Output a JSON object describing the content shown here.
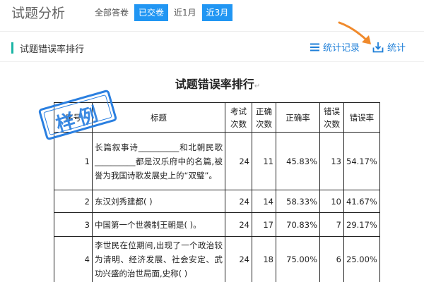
{
  "header": {
    "title": "试题分析",
    "filters": [
      {
        "label": "全部答卷",
        "active": false
      },
      {
        "label": "已交卷",
        "active": true
      },
      {
        "label": "近1月",
        "active": false
      },
      {
        "label": "近3月",
        "active": true
      }
    ]
  },
  "card": {
    "title": "试题错误率排行",
    "actions": {
      "records": "统计记录",
      "stats": "统计"
    },
    "accent_color": "#1bb5a5",
    "link_color": "#1e7fd8"
  },
  "document": {
    "title": "试题错误率排行",
    "return_mark": "↵",
    "stamp": "样例",
    "table": {
      "headers": [
        "序号",
        "标题",
        "考试次数",
        "正确次数",
        "正确率",
        "错误次数",
        "错误率"
      ],
      "rows": [
        {
          "index": "1",
          "title": "长篇叙事诗__________和北朝民歌__________都是汉乐府中的名篇,被誉为我国诗歌发展史上的“双璧”。",
          "exams": "24",
          "correct": "11",
          "correct_rate": "45.83%",
          "wrong": "13",
          "wrong_rate": "54.17%"
        },
        {
          "index": "2",
          "title": "东汉刘秀建都( )",
          "exams": "24",
          "correct": "14",
          "correct_rate": "58.33%",
          "wrong": "10",
          "wrong_rate": "41.67%"
        },
        {
          "index": "3",
          "title": "中国第一个世袭制王朝是( )。",
          "exams": "24",
          "correct": "17",
          "correct_rate": "70.83%",
          "wrong": "7",
          "wrong_rate": "29.17%"
        },
        {
          "index": "4",
          "title": "李世民在位期间,出现了一个政治较为清明、经济发展、社会安定、武功兴盛的治世局面,史称( )",
          "exams": "24",
          "correct": "18",
          "correct_rate": "75.00%",
          "wrong": "6",
          "wrong_rate": "25.00%"
        }
      ]
    }
  },
  "colors": {
    "primary": "#2196f3",
    "annotation_arrow": "#f08a2c",
    "stamp": "#2a7fe0"
  }
}
